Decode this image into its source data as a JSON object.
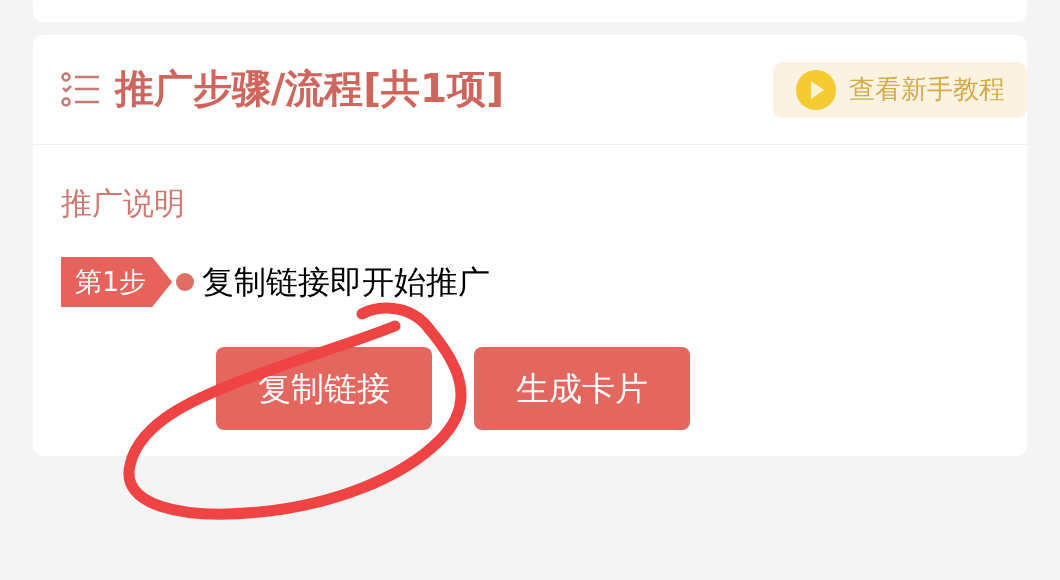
{
  "section": {
    "title": "推广步骤/流程[共1项]",
    "tutorial_button": "查看新手教程"
  },
  "description_label": "推广说明",
  "steps": [
    {
      "badge": "第1步",
      "text": "复制链接即开始推广"
    }
  ],
  "buttons": [
    {
      "label": "复制链接"
    },
    {
      "label": "生成卡片"
    }
  ]
}
